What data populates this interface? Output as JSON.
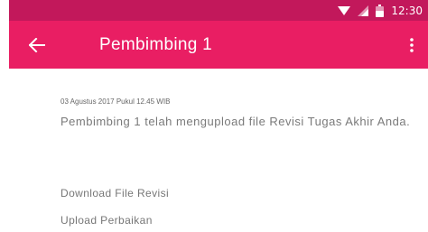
{
  "status_bar": {
    "time": "12:30",
    "bar_color": "#c2185b",
    "icons": [
      "wifi-icon",
      "signal-icon",
      "battery-icon"
    ]
  },
  "app_bar": {
    "title": "Pembimbing 1",
    "bar_color": "#e91e63",
    "icons": [
      "back-arrow-icon",
      "more-vert-icon"
    ]
  },
  "notification": {
    "date": "03 Agustus 2017 Pukul 12.45 WIB",
    "message": "Pembimbing 1 telah mengupload file Revisi Tugas Akhir Anda."
  },
  "actions": {
    "download_label": "Download File Revisi",
    "upload_label": "Upload Perbaikan"
  }
}
